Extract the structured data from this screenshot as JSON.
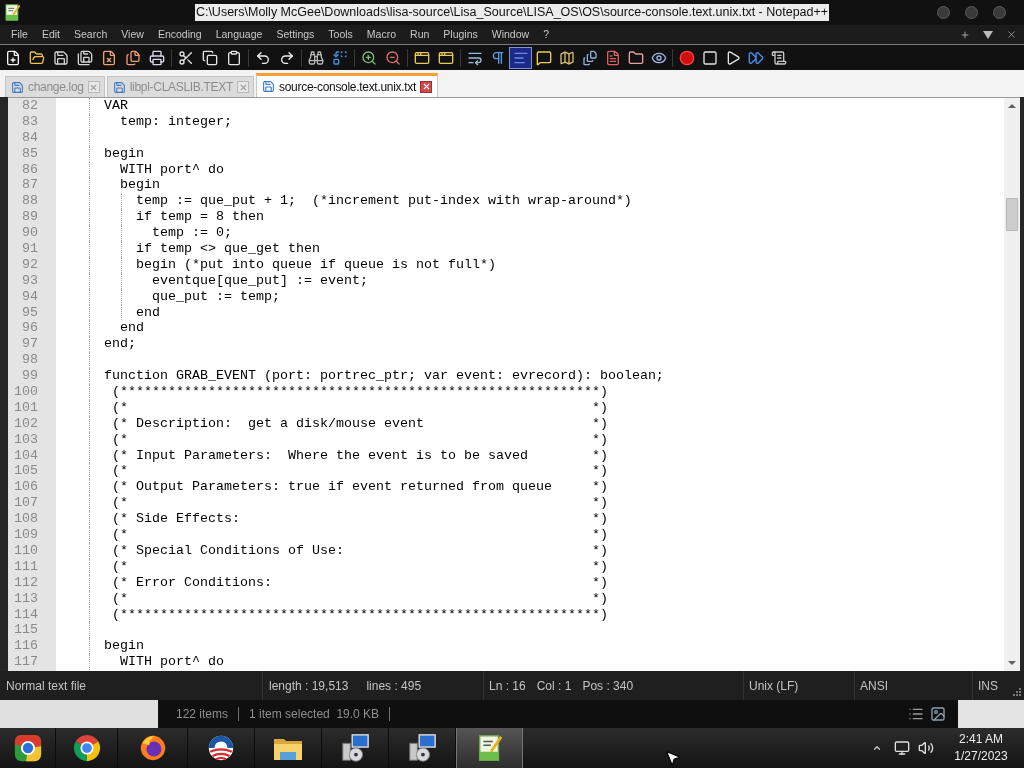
{
  "window": {
    "title": "C:\\Users\\Molly McGee\\Downloads\\lisa-source\\Lisa_Source\\LISA_OS\\OS\\source-console.text.unix.txt - Notepad++"
  },
  "menu": [
    "File",
    "Edit",
    "Search",
    "View",
    "Encoding",
    "Language",
    "Settings",
    "Tools",
    "Macro",
    "Run",
    "Plugins",
    "Window",
    "?"
  ],
  "toolbar": [
    {
      "buttons": [
        {
          "kind": "new",
          "selected": false
        },
        {
          "kind": "open",
          "selected": false
        },
        {
          "kind": "save",
          "selected": false
        },
        {
          "kind": "save-all",
          "selected": false
        },
        {
          "kind": "close",
          "selected": false
        },
        {
          "kind": "close-all",
          "selected": false
        },
        {
          "kind": "print",
          "selected": false
        }
      ]
    },
    {
      "buttons": [
        {
          "kind": "cut",
          "selected": false
        },
        {
          "kind": "copy",
          "selected": false
        },
        {
          "kind": "paste",
          "selected": false
        }
      ]
    },
    {
      "buttons": [
        {
          "kind": "undo",
          "selected": false
        },
        {
          "kind": "redo",
          "selected": false
        }
      ]
    },
    {
      "buttons": [
        {
          "kind": "find",
          "selected": false
        },
        {
          "kind": "replace",
          "selected": false
        }
      ]
    },
    {
      "buttons": [
        {
          "kind": "zoom-in",
          "selected": false
        },
        {
          "kind": "zoom-out",
          "selected": false
        }
      ]
    },
    {
      "buttons": [
        {
          "kind": "sync-vertical",
          "selected": false
        },
        {
          "kind": "sync-horizontal",
          "selected": false
        }
      ]
    },
    {
      "buttons": [
        {
          "kind": "wrap",
          "selected": false
        },
        {
          "kind": "all-characters",
          "selected": false
        },
        {
          "kind": "indent-guide",
          "selected": true
        },
        {
          "kind": "bubble",
          "selected": false
        },
        {
          "kind": "map",
          "selected": false
        },
        {
          "kind": "documents",
          "selected": false
        },
        {
          "kind": "document",
          "selected": false
        },
        {
          "kind": "folder",
          "selected": false
        },
        {
          "kind": "eye",
          "selected": false
        }
      ]
    },
    {
      "buttons": [
        {
          "kind": "record",
          "selected": false
        },
        {
          "kind": "stop",
          "selected": false
        },
        {
          "kind": "play",
          "selected": false
        },
        {
          "kind": "fast-forward",
          "selected": false
        },
        {
          "kind": "save-macro",
          "selected": false
        }
      ]
    }
  ],
  "tabs": [
    {
      "label": "change.log",
      "selected": false
    },
    {
      "label": "libpl-CLASLIB.TEXT",
      "selected": false
    },
    {
      "label": "source-console.text.unix.txt",
      "selected": true
    }
  ],
  "editor": {
    "lines": [
      {
        "number": "82",
        "text": "      VAR"
      },
      {
        "number": "83",
        "text": "        temp: integer;"
      },
      {
        "number": "84"
      },
      {
        "number": "85",
        "text": "      begin"
      },
      {
        "number": "86",
        "text": "        WITH port^ do"
      },
      {
        "number": "87",
        "text": "        begin"
      },
      {
        "number": "88",
        "text": "          temp := que_put + 1;  (*increment put-index with wrap-around*)"
      },
      {
        "number": "89",
        "text": "          if temp = 8 then"
      },
      {
        "number": "90",
        "text": "            temp := 0;"
      },
      {
        "number": "91",
        "text": "          if temp <> que_get then"
      },
      {
        "number": "92",
        "text": "          begin (*put into queue if queue is not full*)"
      },
      {
        "number": "93",
        "text": "            eventque[que_put] := event;"
      },
      {
        "number": "94",
        "text": "            que_put := temp;"
      },
      {
        "number": "95",
        "text": "          end"
      },
      {
        "number": "96",
        "text": "        end"
      },
      {
        "number": "97",
        "text": "      end;"
      },
      {
        "number": "98"
      },
      {
        "number": "99",
        "text": "      function GRAB_EVENT (port: portrec_ptr; var event: evrecord): boolean;"
      },
      {
        "number": "100",
        "text": "       (************************************************************)"
      },
      {
        "number": "101",
        "text": "       (*                                                          *)"
      },
      {
        "number": "102",
        "text": "       (* Description:  get a disk/mouse event                     *)"
      },
      {
        "number": "103",
        "text": "       (*                                                          *)"
      },
      {
        "number": "104",
        "text": "       (* Input Parameters:  Where the event is to be saved        *)"
      },
      {
        "number": "105",
        "text": "       (*                                                          *)"
      },
      {
        "number": "106",
        "text": "       (* Output Parameters: true if event returned from queue     *)"
      },
      {
        "number": "107",
        "text": "       (*                                                          *)"
      },
      {
        "number": "108",
        "text": "       (* Side Effects:                                            *)"
      },
      {
        "number": "109",
        "text": "       (*                                                          *)"
      },
      {
        "number": "110",
        "text": "       (* Special Conditions of Use:                               *)"
      },
      {
        "number": "111",
        "text": "       (*                                                          *)"
      },
      {
        "number": "112",
        "text": "       (* Error Conditions:                                        *)"
      },
      {
        "number": "113",
        "text": "       (*                                                          *)"
      },
      {
        "number": "114",
        "text": "       (************************************************************)"
      },
      {
        "number": "115"
      },
      {
        "number": "116",
        "text": "      begin"
      },
      {
        "number": "117",
        "text": "        WITH port^ do"
      }
    ]
  },
  "status_bar": {
    "file_type": "Normal text file",
    "length": "length : 19,513",
    "lines": "lines : 495",
    "line": "Ln : 16",
    "column": "Col : 1",
    "position": "Pos : 340",
    "line_ending": "Unix (LF)",
    "encoding": "ANSI",
    "mode": "INS"
  },
  "explorer_status": {
    "items": "122 items",
    "selection": "1 item selected  19.0 KB"
  },
  "taskbar": {
    "apps": [
      {
        "kind": "tricolor",
        "selected": false
      },
      {
        "kind": "ring",
        "selected": false
      },
      {
        "kind": "flame",
        "selected": false
      },
      {
        "kind": "emblem",
        "selected": false
      },
      {
        "kind": "folder",
        "selected": false
      },
      {
        "kind": "installer",
        "selected": false
      },
      {
        "kind": "installer",
        "selected": false
      },
      {
        "kind": "notepad",
        "selected": true
      }
    ],
    "time": "2:41 AM",
    "date": "1/27/2023"
  }
}
